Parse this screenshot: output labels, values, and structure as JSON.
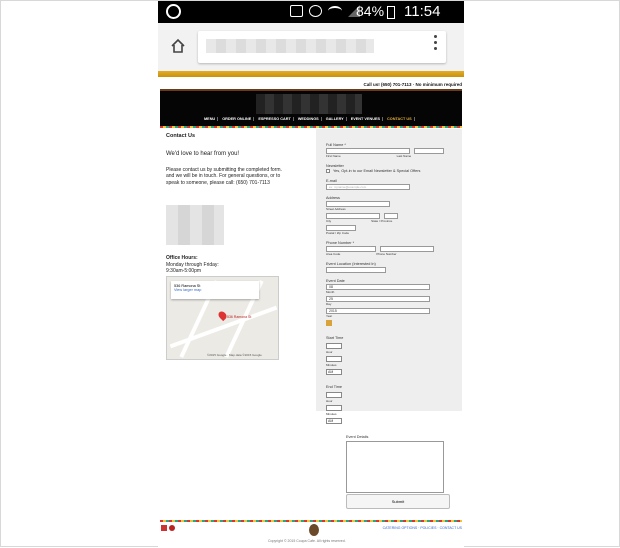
{
  "status_bar": {
    "battery": "84%",
    "time": "11:54 AM"
  },
  "site": {
    "call_us": "Call us! (650) 701-7113 · No minimum required",
    "nav": [
      "MENU",
      "ORDER ONLINE",
      "ESPRESSO CART",
      "WEDDINGS",
      "GALLERY",
      "EVENT VENUES",
      "CONTACT US"
    ],
    "active_nav": "CONTACT US"
  },
  "contact": {
    "heading": "Contact Us",
    "love": "We'd love to hear from you!",
    "intro1": "Please contact us by submitting the completed form.",
    "intro2": "and we will be in touch. For general questions, or to speak to someone, please call: (650) 701-7113",
    "hours_title": "Office Hours:",
    "hours_line1": "Monday through Friday:",
    "hours_line2": "9:30am-5:00pm"
  },
  "map": {
    "address": "536 Ramona St",
    "link": "View larger map",
    "pin_label": "536 Ramona St",
    "footer": "©2015 Google · Map data ©2015 Google"
  },
  "form": {
    "full_name": "Full Name *",
    "first": "First Name",
    "last": "Last Name",
    "newsletter": "Newsletter",
    "newsletter_opt": "Yes, Opt-in to our Email Newsletter & Special Offers",
    "email": "E-mail",
    "email_placeholder": "ex: myname@example.com",
    "address": "Address",
    "street": "Street Address",
    "city": "City",
    "state": "State / Province",
    "zip": "Postal / Zip Code",
    "phone": "Phone Number *",
    "area": "Area Code",
    "phone_num": "Phone Number",
    "location": "Event Location (Interested In)",
    "event_date": "Event Date",
    "month_val": "08",
    "day_val": "25",
    "year_val": "2015",
    "month": "Month",
    "day": "Day",
    "year": "Year",
    "start_time": "Start Time",
    "end_time": "End Time",
    "hour": "Hour",
    "minutes": "Minutes",
    "ampm": "AM",
    "details": "Event Details",
    "submit": "Submit"
  },
  "footer": {
    "links": "CATERING OPTIONS · POLICIES · CONTACT US",
    "copyright": "Copyright © 2015 Coupa Cafe. All rights reserved."
  }
}
